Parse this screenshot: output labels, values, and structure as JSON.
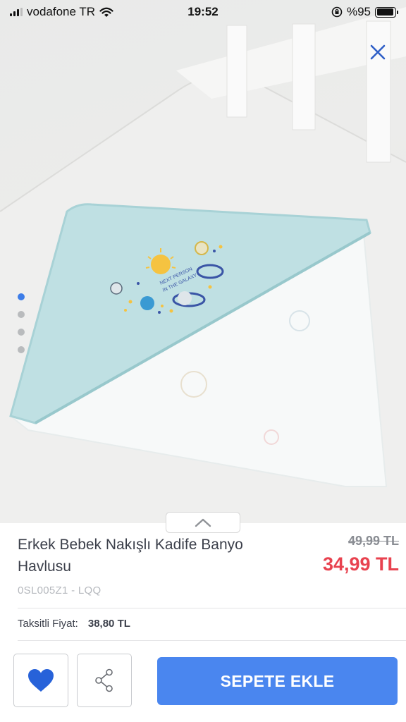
{
  "status_bar": {
    "carrier": "vodafone TR",
    "time": "19:52",
    "battery": "%95",
    "battery_level": 0.95
  },
  "gallery": {
    "image_count": 4,
    "active_index": 0,
    "close_icon": "close-icon"
  },
  "product": {
    "title": "Erkek Bebek Nakışlı Kadife Banyo Havlusu",
    "old_price": "49,99 TL",
    "price": "34,99 TL",
    "sku": "0SL005Z1 - LQQ",
    "installment_label": "Taksitli Fiyat:",
    "installment_value": "38,80 TL"
  },
  "actions": {
    "favorite_icon": "heart-icon",
    "share_icon": "share-icon",
    "add_to_cart_label": "SEPETE EKLE"
  },
  "colors": {
    "accent": "#4a86ef",
    "sale_price": "#e8424f",
    "active_dot": "#3d7de8",
    "heart": "#2762d9"
  }
}
